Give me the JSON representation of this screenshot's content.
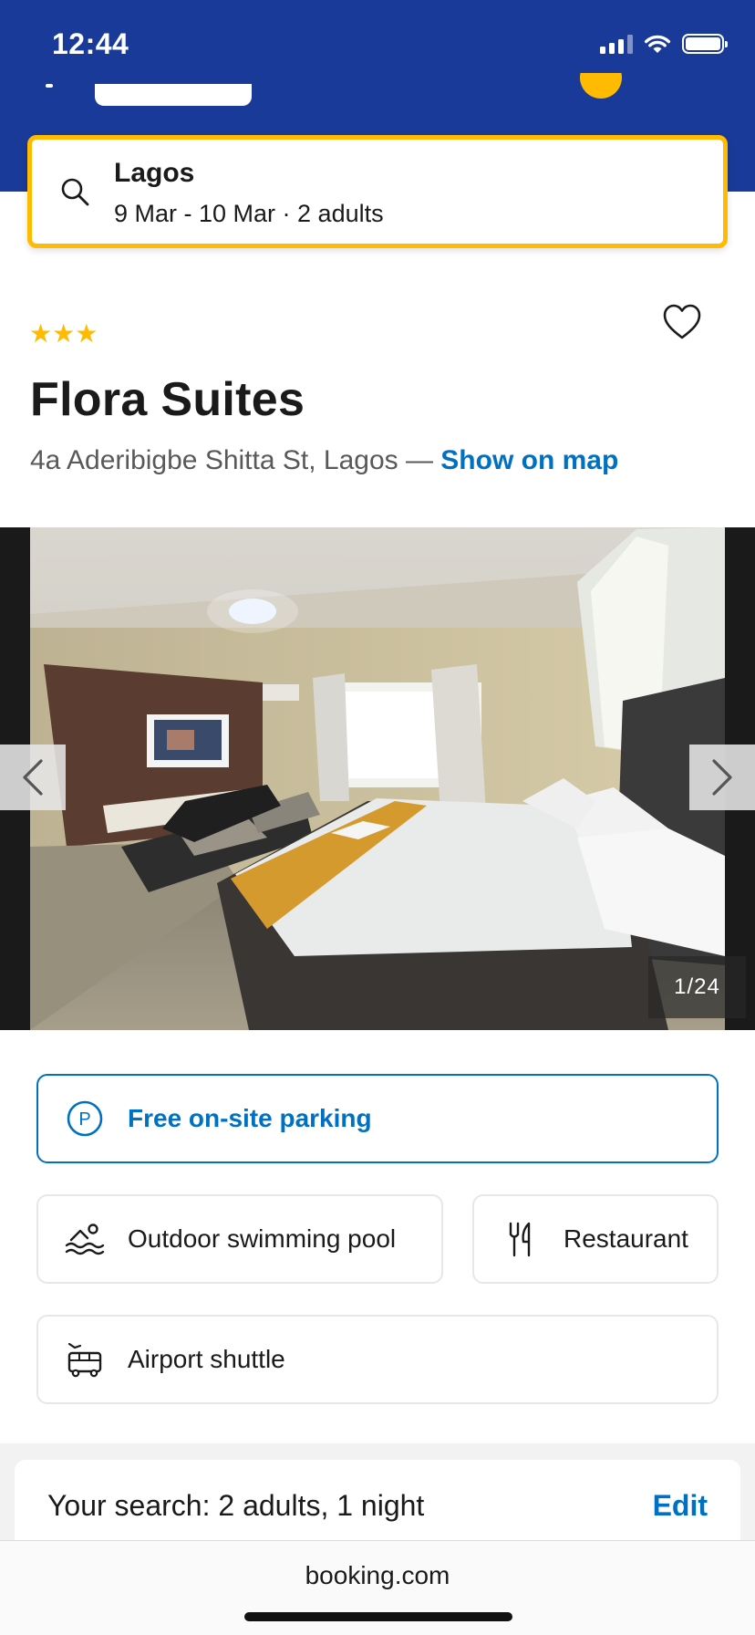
{
  "status_bar": {
    "time": "12:44"
  },
  "search": {
    "city": "Lagos",
    "meta": "9 Mar - 10 Mar · 2 adults"
  },
  "property": {
    "stars": "★★★",
    "name": "Flora Suites",
    "address": "4a Aderibigbe Shitta St, Lagos — ",
    "map_link": "Show on map"
  },
  "gallery": {
    "counter": "1/24"
  },
  "facilities": {
    "parking": "Free on-site parking",
    "pool": "Outdoor swimming pool",
    "restaurant": "Restaurant",
    "shuttle": "Airport shuttle"
  },
  "your_search": {
    "summary": "Your search: 2 adults, 1 night",
    "edit": "Edit"
  },
  "browser": {
    "url": "booking.com"
  },
  "colors": {
    "brand_blue": "#1a3a99",
    "accent_yellow": "#febb02",
    "link_blue": "#0071c2"
  },
  "icons": [
    "search-icon",
    "heart-icon",
    "chevron-left-icon",
    "chevron-right-icon",
    "parking-icon",
    "pool-icon",
    "restaurant-icon",
    "shuttle-icon"
  ]
}
